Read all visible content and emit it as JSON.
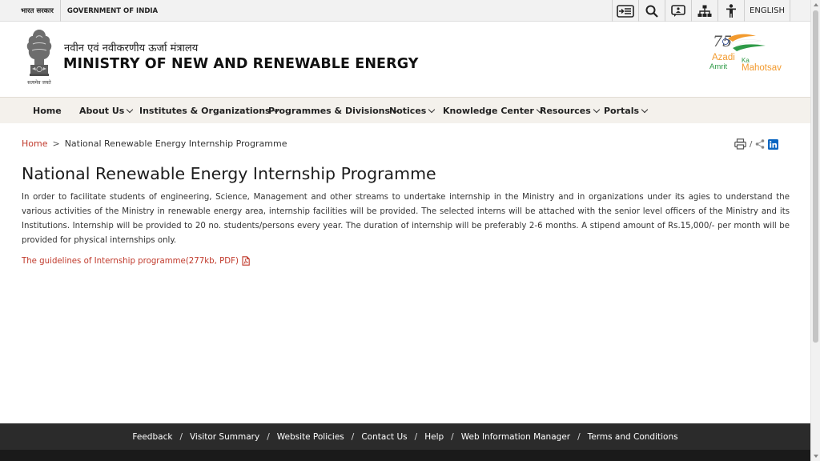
{
  "topbar": {
    "gov_hindi": "भारत सरकार",
    "gov_english": "GOVERNMENT OF INDIA",
    "tools": [
      {
        "name": "skip-to-content-icon"
      },
      {
        "name": "search-icon"
      },
      {
        "name": "screen-reader-icon"
      },
      {
        "name": "sitemap-icon"
      },
      {
        "name": "accessibility-icon"
      }
    ],
    "language": "ENGLISH"
  },
  "header": {
    "ministry_hindi": "नवीन एवं नवीकरणीय ऊर्जा मंत्रालय",
    "ministry_english": "MINISTRY OF NEW AND RENEWABLE ENERGY",
    "emblem_caption": "सत्यमेव जयते",
    "akam_logo": {
      "line1": "Azadi",
      "ka": "Ka",
      "line2": "Amrit",
      "line3": "Mahotsav",
      "number": "75"
    },
    "colors": {
      "saffron": "#f29a2e",
      "green": "#2e9a47",
      "navy": "#1b3a8a"
    }
  },
  "nav": {
    "items": [
      {
        "label": "Home",
        "dropdown": false
      },
      {
        "label": "About Us",
        "dropdown": true
      },
      {
        "label": "Institutes & Organizations",
        "dropdown": true
      },
      {
        "label": "Programmes & Divisions",
        "dropdown": true
      },
      {
        "label": "Notices",
        "dropdown": true
      },
      {
        "label": "Knowledge Center",
        "dropdown": true
      },
      {
        "label": "Resources",
        "dropdown": true
      },
      {
        "label": "Portals",
        "dropdown": true
      }
    ]
  },
  "breadcrumb": {
    "home": "Home",
    "separator": ">",
    "current": "National Renewable Energy Internship Programme"
  },
  "share": {
    "divider": "/"
  },
  "content": {
    "title": "National Renewable Energy Internship Programme",
    "paragraph": "In order to facilitate students of engineering, Science, Management and other streams to undertake internship in the Ministry and in organizations under its agies to understand the various activities of the Ministry in renewable energy area, internship facilities will be provided. The selected interns will be attached with the senior level officers of the Ministry and its Institutions. Internship will be provided to 20 no. students/persons every year. The duration of internship will be preferably 2-6 months. A stipend amount of Rs.15,000/- per month will be provided for physical internships only.",
    "guideline_link": "The guidelines of Internship programme(277kb, PDF)"
  },
  "footer": {
    "links": [
      "Feedback",
      "Visitor Summary",
      "Website Policies",
      "Contact Us",
      "Help",
      "Web Information Manager",
      "Terms and Conditions"
    ],
    "separator": "/"
  }
}
